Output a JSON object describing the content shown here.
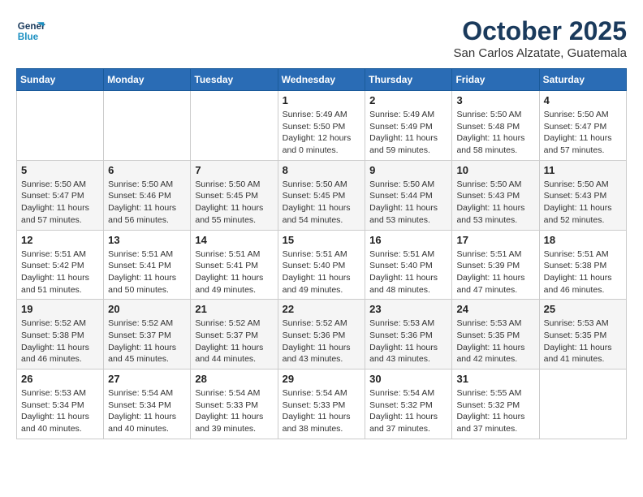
{
  "logo": {
    "line1": "General",
    "line2": "Blue"
  },
  "title": "October 2025",
  "subtitle": "San Carlos Alzatate, Guatemala",
  "weekdays": [
    "Sunday",
    "Monday",
    "Tuesday",
    "Wednesday",
    "Thursday",
    "Friday",
    "Saturday"
  ],
  "weeks": [
    [
      {
        "day": "",
        "info": ""
      },
      {
        "day": "",
        "info": ""
      },
      {
        "day": "",
        "info": ""
      },
      {
        "day": "1",
        "info": "Sunrise: 5:49 AM\nSunset: 5:50 PM\nDaylight: 12 hours\nand 0 minutes."
      },
      {
        "day": "2",
        "info": "Sunrise: 5:49 AM\nSunset: 5:49 PM\nDaylight: 11 hours\nand 59 minutes."
      },
      {
        "day": "3",
        "info": "Sunrise: 5:50 AM\nSunset: 5:48 PM\nDaylight: 11 hours\nand 58 minutes."
      },
      {
        "day": "4",
        "info": "Sunrise: 5:50 AM\nSunset: 5:47 PM\nDaylight: 11 hours\nand 57 minutes."
      }
    ],
    [
      {
        "day": "5",
        "info": "Sunrise: 5:50 AM\nSunset: 5:47 PM\nDaylight: 11 hours\nand 57 minutes."
      },
      {
        "day": "6",
        "info": "Sunrise: 5:50 AM\nSunset: 5:46 PM\nDaylight: 11 hours\nand 56 minutes."
      },
      {
        "day": "7",
        "info": "Sunrise: 5:50 AM\nSunset: 5:45 PM\nDaylight: 11 hours\nand 55 minutes."
      },
      {
        "day": "8",
        "info": "Sunrise: 5:50 AM\nSunset: 5:45 PM\nDaylight: 11 hours\nand 54 minutes."
      },
      {
        "day": "9",
        "info": "Sunrise: 5:50 AM\nSunset: 5:44 PM\nDaylight: 11 hours\nand 53 minutes."
      },
      {
        "day": "10",
        "info": "Sunrise: 5:50 AM\nSunset: 5:43 PM\nDaylight: 11 hours\nand 53 minutes."
      },
      {
        "day": "11",
        "info": "Sunrise: 5:50 AM\nSunset: 5:43 PM\nDaylight: 11 hours\nand 52 minutes."
      }
    ],
    [
      {
        "day": "12",
        "info": "Sunrise: 5:51 AM\nSunset: 5:42 PM\nDaylight: 11 hours\nand 51 minutes."
      },
      {
        "day": "13",
        "info": "Sunrise: 5:51 AM\nSunset: 5:41 PM\nDaylight: 11 hours\nand 50 minutes."
      },
      {
        "day": "14",
        "info": "Sunrise: 5:51 AM\nSunset: 5:41 PM\nDaylight: 11 hours\nand 49 minutes."
      },
      {
        "day": "15",
        "info": "Sunrise: 5:51 AM\nSunset: 5:40 PM\nDaylight: 11 hours\nand 49 minutes."
      },
      {
        "day": "16",
        "info": "Sunrise: 5:51 AM\nSunset: 5:40 PM\nDaylight: 11 hours\nand 48 minutes."
      },
      {
        "day": "17",
        "info": "Sunrise: 5:51 AM\nSunset: 5:39 PM\nDaylight: 11 hours\nand 47 minutes."
      },
      {
        "day": "18",
        "info": "Sunrise: 5:51 AM\nSunset: 5:38 PM\nDaylight: 11 hours\nand 46 minutes."
      }
    ],
    [
      {
        "day": "19",
        "info": "Sunrise: 5:52 AM\nSunset: 5:38 PM\nDaylight: 11 hours\nand 46 minutes."
      },
      {
        "day": "20",
        "info": "Sunrise: 5:52 AM\nSunset: 5:37 PM\nDaylight: 11 hours\nand 45 minutes."
      },
      {
        "day": "21",
        "info": "Sunrise: 5:52 AM\nSunset: 5:37 PM\nDaylight: 11 hours\nand 44 minutes."
      },
      {
        "day": "22",
        "info": "Sunrise: 5:52 AM\nSunset: 5:36 PM\nDaylight: 11 hours\nand 43 minutes."
      },
      {
        "day": "23",
        "info": "Sunrise: 5:53 AM\nSunset: 5:36 PM\nDaylight: 11 hours\nand 43 minutes."
      },
      {
        "day": "24",
        "info": "Sunrise: 5:53 AM\nSunset: 5:35 PM\nDaylight: 11 hours\nand 42 minutes."
      },
      {
        "day": "25",
        "info": "Sunrise: 5:53 AM\nSunset: 5:35 PM\nDaylight: 11 hours\nand 41 minutes."
      }
    ],
    [
      {
        "day": "26",
        "info": "Sunrise: 5:53 AM\nSunset: 5:34 PM\nDaylight: 11 hours\nand 40 minutes."
      },
      {
        "day": "27",
        "info": "Sunrise: 5:54 AM\nSunset: 5:34 PM\nDaylight: 11 hours\nand 40 minutes."
      },
      {
        "day": "28",
        "info": "Sunrise: 5:54 AM\nSunset: 5:33 PM\nDaylight: 11 hours\nand 39 minutes."
      },
      {
        "day": "29",
        "info": "Sunrise: 5:54 AM\nSunset: 5:33 PM\nDaylight: 11 hours\nand 38 minutes."
      },
      {
        "day": "30",
        "info": "Sunrise: 5:54 AM\nSunset: 5:32 PM\nDaylight: 11 hours\nand 37 minutes."
      },
      {
        "day": "31",
        "info": "Sunrise: 5:55 AM\nSunset: 5:32 PM\nDaylight: 11 hours\nand 37 minutes."
      },
      {
        "day": "",
        "info": ""
      }
    ]
  ]
}
